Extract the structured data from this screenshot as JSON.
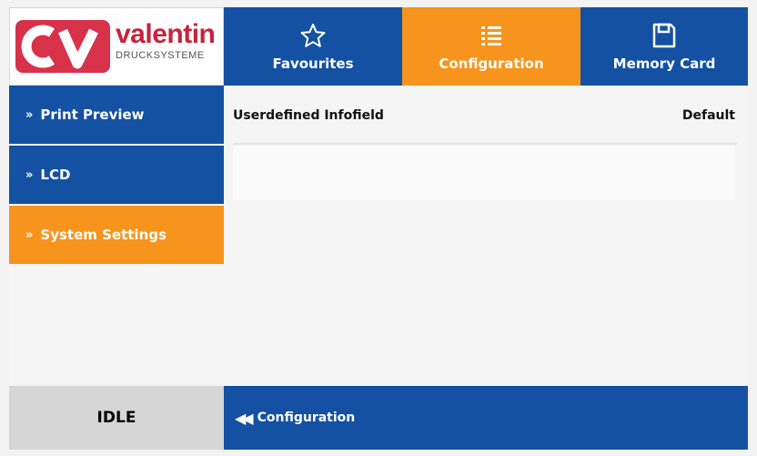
{
  "logo": {
    "mark": "CV",
    "name": "valentin",
    "subtitle": "DRUCKSYSTEME"
  },
  "tabs": [
    {
      "label": "Favourites",
      "icon": "star-icon"
    },
    {
      "label": "Configuration",
      "icon": "list-icon",
      "active": true
    },
    {
      "label": "Memory Card",
      "icon": "floppy-disk-icon"
    }
  ],
  "sidebar": {
    "items": [
      {
        "label": "Print Preview"
      },
      {
        "label": "LCD"
      },
      {
        "label": "System Settings",
        "active": true
      }
    ]
  },
  "content": {
    "rows": [
      {
        "label": "Userdefined Infofield",
        "value": "Default"
      }
    ]
  },
  "footer": {
    "status": "IDLE",
    "back_label": "Configuration"
  },
  "colors": {
    "blue": "#1451a3",
    "orange": "#f7941d",
    "brand_red": "#c4243b",
    "status_gray": "#d6d6d6"
  }
}
